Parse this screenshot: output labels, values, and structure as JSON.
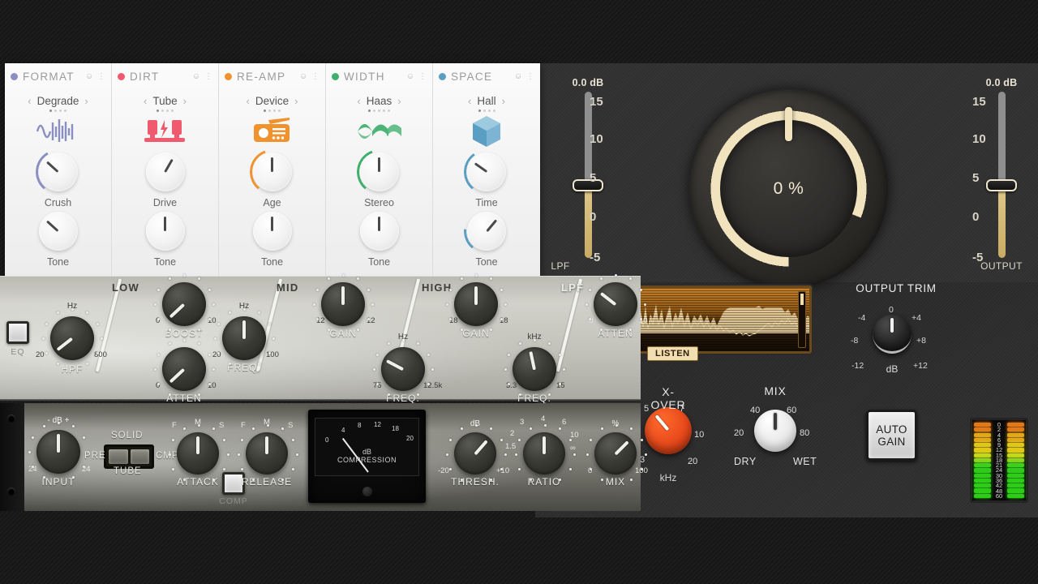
{
  "modules": [
    {
      "name": "FORMAT",
      "dot_color": "#8b8fbf",
      "preset": "Degrade",
      "glyph": "waveform-glitch-icon",
      "dot_index": 0,
      "dot_count": 4,
      "knobs": [
        {
          "label": "Crush",
          "angle": -48,
          "ring": true,
          "ring_color": "#8b8fbf",
          "ring_deg": 110
        },
        {
          "label": "Tone",
          "angle": -48,
          "ring": false
        }
      ]
    },
    {
      "name": "DIRT",
      "dot_color": "#ef5a6f",
      "preset": "Tube",
      "glyph": "tube-amp-icon",
      "dot_index": 0,
      "dot_count": 4,
      "knobs": [
        {
          "label": "Drive",
          "angle": 30,
          "ring": false
        },
        {
          "label": "Tone",
          "angle": 0,
          "ring": false
        }
      ]
    },
    {
      "name": "RE-AMP",
      "dot_color": "#f0922e",
      "preset": "Device",
      "glyph": "radio-icon",
      "dot_index": 0,
      "dot_count": 4,
      "knobs": [
        {
          "label": "Age",
          "angle": 0,
          "ring": true,
          "ring_color": "#f0922e",
          "ring_deg": 120
        },
        {
          "label": "Tone",
          "angle": 0,
          "ring": false
        }
      ]
    },
    {
      "name": "WIDTH",
      "dot_color": "#3faf6e",
      "preset": "Haas",
      "glyph": "stereo-wave-icon",
      "dot_index": 0,
      "dot_count": 5,
      "knobs": [
        {
          "label": "Stereo",
          "angle": 0,
          "ring": true,
          "ring_color": "#3faf6e",
          "ring_deg": 120
        },
        {
          "label": "Tone",
          "angle": 0,
          "ring": false
        }
      ]
    },
    {
      "name": "SPACE",
      "dot_color": "#5a9ec4",
      "preset": "Hall",
      "glyph": "cube-icon",
      "dot_index": 0,
      "dot_count": 4,
      "knobs": [
        {
          "label": "Time",
          "angle": -55,
          "ring": true,
          "ring_color": "#5a9ec4",
          "ring_deg": 105
        },
        {
          "label": "Tone",
          "angle": 40,
          "ring": true,
          "ring_color": "#5a9ec4",
          "ring_deg": 55
        }
      ]
    }
  ],
  "eq": {
    "section_button": "eq-bypass-button",
    "section_label": "EQ",
    "bands": [
      {
        "label": "LOW"
      },
      {
        "label": "MID"
      },
      {
        "label": "HIGH"
      },
      {
        "label": "LPF"
      }
    ],
    "knobs": [
      {
        "name": "hpf",
        "label": "HPF",
        "unit": "Hz",
        "min": "20",
        "max": "800",
        "angle": -128
      },
      {
        "name": "low-boost",
        "label": "BOOST",
        "unit": "",
        "min": "0",
        "max": "10",
        "angle": -133
      },
      {
        "name": "low-atten",
        "label": "ATTEN",
        "unit": "",
        "min": "0",
        "max": "10",
        "angle": -133
      },
      {
        "name": "low-freq",
        "label": "FREQ.",
        "unit": "Hz",
        "min": "20",
        "max": "100",
        "angle": 0
      },
      {
        "name": "mid-gain",
        "label": "GAIN",
        "unit": "",
        "min": "12",
        "max": "12",
        "angle": 0
      },
      {
        "name": "mid-freq",
        "label": "FREQ.",
        "unit": "Hz",
        "min": "75",
        "max": "12.5k",
        "angle": -62
      },
      {
        "name": "high-gain",
        "label": "GAIN",
        "unit": "",
        "min": "18",
        "max": "18",
        "angle": 0
      },
      {
        "name": "high-freq",
        "label": "FREQ.",
        "unit": "kHz",
        "min": "3.3",
        "max": "15",
        "angle": -12
      },
      {
        "name": "lpf-atten",
        "label": "ATTEN",
        "unit": "",
        "min": "0",
        "max": "10",
        "angle": -52
      }
    ]
  },
  "comp": {
    "input": {
      "label": "INPUT",
      "unit": "- dB +",
      "min": "24",
      "max": "24",
      "angle": 0
    },
    "toggle": {
      "top_label": "SOLID",
      "bottom_label": "TUBE",
      "left_label": "PRE",
      "right_label": "CMP"
    },
    "attack": {
      "label": "ATTACK",
      "marks": [
        "F",
        "M",
        "S"
      ],
      "angle": 0
    },
    "release": {
      "label": "RELEASE",
      "marks": [
        "F",
        "M",
        "S"
      ],
      "angle": 0
    },
    "comp_button_label": "COMP",
    "vu": {
      "unit": "dB",
      "title": "COMPRESSION",
      "ticks": [
        "0",
        "4",
        "8",
        "12",
        "18",
        "20"
      ]
    },
    "thresh": {
      "label": "THRESH.",
      "unit": "dB",
      "min": "-20",
      "max": "+10",
      "angle": 41
    },
    "ratio": {
      "label": "RATIO",
      "unit": "",
      "marks": [
        "1.5",
        "2",
        "3",
        "4",
        "6",
        "10",
        "∞"
      ],
      "angle": 0
    },
    "mix": {
      "label": "MIX",
      "unit": "%",
      "min": "0",
      "max": "100",
      "angle": 45
    }
  },
  "right": {
    "lpf_fader": {
      "value": "0.0 dB",
      "label": "LPF",
      "ticks": [
        "15",
        "10",
        "5",
        "0",
        "-5"
      ]
    },
    "output_fader": {
      "value": "0.0 dB",
      "label": "OUTPUT",
      "ticks": [
        "15",
        "10",
        "5",
        "0",
        "-5"
      ]
    },
    "big_dial": {
      "value": "0 %",
      "name": "master-amount-dial",
      "arc_color": "#f0e3bd"
    },
    "scope": {
      "button_label": "LISTEN"
    },
    "xover": {
      "label": "X-OVER",
      "unit": "kHz",
      "marks": [
        "3",
        "5",
        "7",
        "10",
        "20"
      ],
      "angle": -40,
      "color": "#e8491b"
    },
    "mix": {
      "label": "MIX",
      "left": "DRY",
      "right": "WET",
      "marks": [
        "20",
        "40",
        "60",
        "80"
      ],
      "angle": 0
    },
    "output_trim": {
      "label": "OUTPUT TRIM",
      "unit": "dB",
      "marks": [
        "-12",
        "-8",
        "-4",
        "0",
        "+4",
        "+8",
        "+12"
      ],
      "angle": 0
    },
    "auto_gain": {
      "line1": "AUTO",
      "line2": "GAIN"
    },
    "led_meter": {
      "scale": [
        "0",
        "2",
        "4",
        "6",
        "9",
        "12",
        "15",
        "18",
        "21",
        "24",
        "30",
        "36",
        "42",
        "48",
        "60"
      ],
      "colors": [
        "#e07a1a",
        "#e07a1a",
        "#e0a81a",
        "#e0a81a",
        "#e0c81a",
        "#e0c81a",
        "#c8d81a",
        "#8ed420",
        "#3fd020",
        "#2ecc18",
        "#2ecc18",
        "#2ecc18",
        "#2ecc18",
        "#2ecc18",
        "#2ecc18"
      ]
    }
  }
}
